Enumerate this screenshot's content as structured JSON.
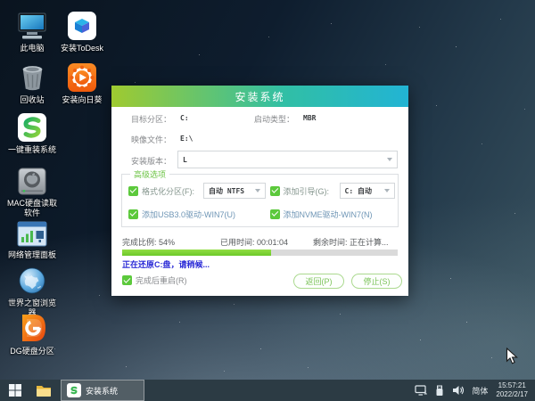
{
  "desktop": {
    "icons": [
      {
        "label": "此电脑"
      },
      {
        "label": "安装ToDesk"
      },
      {
        "label": "回收站"
      },
      {
        "label": "安装向日葵"
      },
      {
        "label": "一键重装系统"
      },
      {
        "label": "MAC硬盘读取软件"
      },
      {
        "label": "网络管理面板"
      },
      {
        "label": "世界之窗浏览器"
      },
      {
        "label": "DG硬盘分区"
      }
    ]
  },
  "dialog": {
    "title": "安装系统",
    "target_partition": {
      "label": "目标分区：",
      "value": "C:"
    },
    "boot_type": {
      "label": "启动类型：",
      "value": "MBR"
    },
    "image_file": {
      "label": "映像文件：",
      "value": "E:\\"
    },
    "install_version": {
      "label": "安装版本：",
      "value": "L"
    },
    "advanced": {
      "legend": "高级选项",
      "format_partition": {
        "label": "格式化分区(F):",
        "value": "自动 NTFS",
        "checked": true
      },
      "add_boot": {
        "label": "添加引导(G):",
        "value": "C: 自动",
        "checked": true
      },
      "usb3_driver": {
        "label": "添加USB3.0驱动-WIN7(U)",
        "checked": true
      },
      "nvme_driver": {
        "label": "添加NVME驱动-WIN7(N)",
        "checked": true
      }
    },
    "progress": {
      "completion": "完成比例: 54%",
      "percent": 54,
      "elapsed": "已用时间: 00:01:04",
      "remaining": "剩余时间: 正在计算...",
      "status": "正在还原C:盘，请稍候..."
    },
    "footer": {
      "reboot": {
        "label": "完成后重启(R)",
        "checked": true
      },
      "back_button": "返回(P)",
      "stop_button": "停止(S)"
    }
  },
  "taskbar": {
    "task": "安装系统",
    "tray": {
      "ime": "简体",
      "time": "15:57:21",
      "date": "2022/2/17"
    }
  },
  "colors": {
    "title_gradient_start": "#9fca30",
    "title_gradient_end": "#22b4d4",
    "accent_green": "#5cc93c",
    "progress_fill": "#6cc829",
    "status_text": "#2929d6"
  }
}
